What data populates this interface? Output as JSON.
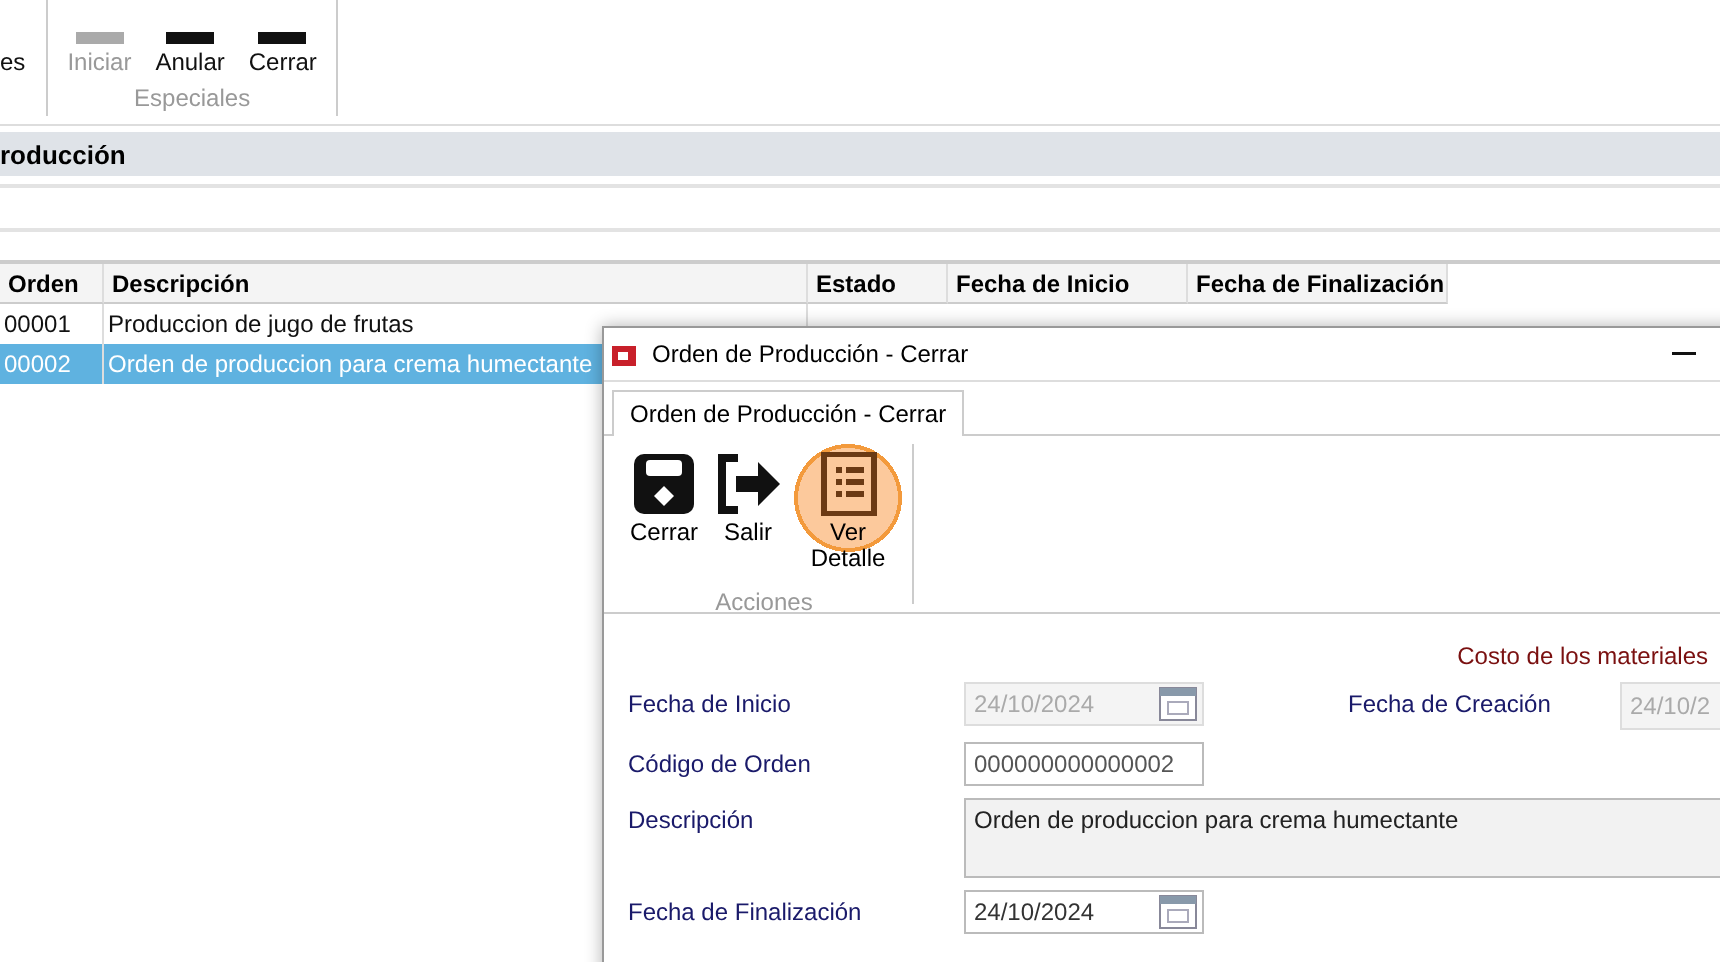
{
  "ribbon": {
    "buttons": [
      {
        "label": "es",
        "disabled": false
      },
      {
        "label": "Iniciar",
        "disabled": true
      },
      {
        "label": "Anular",
        "disabled": false
      },
      {
        "label": "Cerrar",
        "disabled": false
      }
    ],
    "group": "Especiales"
  },
  "section_title": "roducción",
  "table": {
    "columns": [
      "Orden",
      "Descripción",
      "Estado",
      "Fecha de Inicio",
      "Fecha de Finalización"
    ],
    "rows": [
      {
        "cells": [
          "00001",
          "Produccion de jugo de frutas"
        ],
        "selected": false
      },
      {
        "cells": [
          "00002",
          "Orden de produccion para crema humectante"
        ],
        "selected": true
      }
    ]
  },
  "dialog": {
    "title": "Orden de Producción - Cerrar",
    "tab": {
      "label": "Orden de Producción - Cerrar",
      "selected": true
    },
    "actions": [
      {
        "kind": "save",
        "label": "Cerrar",
        "highlighted": false
      },
      {
        "kind": "exit",
        "label": "Salir",
        "highlighted": false
      },
      {
        "kind": "detail",
        "label": "Ver Detalle",
        "highlighted": true
      }
    ],
    "group": "Acciones",
    "cost_label": "Costo de los materiales",
    "fields": [
      {
        "kind": "date",
        "label": "Fecha de Inicio",
        "value": "24/10/2024",
        "disabled": true,
        "side_label": "Fecha de Creación",
        "side_value": "24/10/2"
      },
      {
        "kind": "text",
        "label": "Código de Orden",
        "value": "000000000000002"
      },
      {
        "kind": "area",
        "label": "Descripción",
        "value": "Orden de produccion para crema humectante"
      },
      {
        "kind": "date",
        "label": "Fecha de Finalización",
        "value": "24/10/2024",
        "disabled": false
      }
    ]
  }
}
